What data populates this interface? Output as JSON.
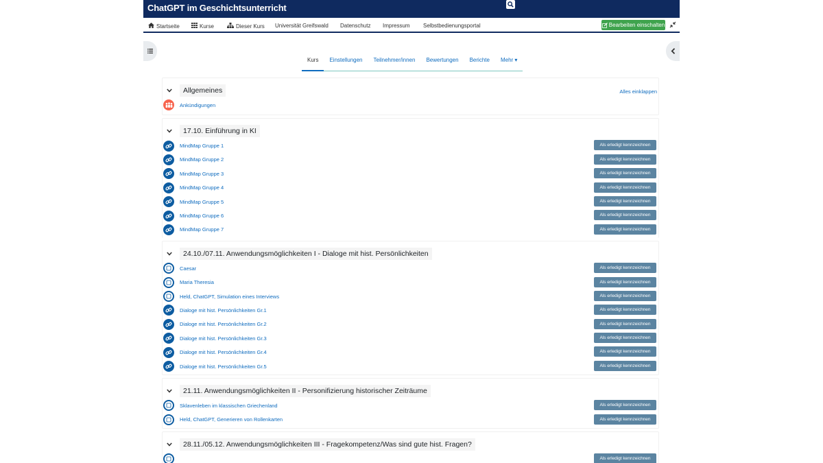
{
  "header": {
    "title": "ChatGPT im Geschichtsunterricht"
  },
  "nav": {
    "items": [
      {
        "label": "Startseite",
        "icon": "home-icon"
      },
      {
        "label": "Kurse",
        "icon": "grid-icon"
      },
      {
        "label": "Dieser Kurs",
        "icon": "sitemap-icon"
      },
      {
        "label": "Universität Greifswald"
      },
      {
        "label": "Datenschutz"
      },
      {
        "label": "Impressum"
      },
      {
        "label": "Selbstbedienungsportal"
      }
    ],
    "edit_label": "Bearbeiten einschalten"
  },
  "tabs": [
    {
      "label": "Kurs",
      "active": true
    },
    {
      "label": "Einstellungen"
    },
    {
      "label": "Teilnehmer/innen"
    },
    {
      "label": "Bewertungen"
    },
    {
      "label": "Berichte"
    },
    {
      "label": "Mehr ▾"
    }
  ],
  "course": {
    "collapse_all_label": "Alles einklappen",
    "done_label": "Als erledigt kennzeichnen",
    "sections": [
      {
        "title": "Allgemeines",
        "activities": [
          {
            "name": "Ankündigungen",
            "type": "forum",
            "done_button": false
          }
        ]
      },
      {
        "title": "17.10. Einführung in KI",
        "activities": [
          {
            "name": "MindMap Gruppe 1",
            "type": "url",
            "done_button": true
          },
          {
            "name": "MindMap Gruppe 2",
            "type": "url",
            "done_button": true
          },
          {
            "name": "MindMap Gruppe 3",
            "type": "url",
            "done_button": true
          },
          {
            "name": "MindMap Gruppe 4",
            "type": "url",
            "done_button": true
          },
          {
            "name": "MindMap Gruppe 5",
            "type": "url",
            "done_button": true
          },
          {
            "name": "MindMap Gruppe 6",
            "type": "url",
            "done_button": true
          },
          {
            "name": "MindMap Gruppe 7",
            "type": "url",
            "done_button": true
          }
        ]
      },
      {
        "title": "24.10./07.11. Anwendungsmöglichkeiten I - Dialoge mit hist. Persönlichkeiten",
        "activities": [
          {
            "name": "Caesar",
            "type": "h5p",
            "done_button": true
          },
          {
            "name": "Maria Theresia",
            "type": "h5p",
            "done_button": true
          },
          {
            "name": "Held, ChatGPT, Simulation eines Interviews",
            "type": "h5p",
            "done_button": true
          },
          {
            "name": "Dialoge mit hist. Persönlichkeiten Gr.1",
            "type": "url",
            "done_button": true
          },
          {
            "name": "Dialoge mit hist. Persönlichkeiten Gr.2",
            "type": "url",
            "done_button": true
          },
          {
            "name": "Dialoge mit hist. Persönlichkeiten Gr.3",
            "type": "url",
            "done_button": true
          },
          {
            "name": "Dialoge mit hist. Persönlichkeiten Gr.4",
            "type": "url",
            "done_button": true
          },
          {
            "name": "Dialoge mit hist. Persönlichkeiten Gr.5",
            "type": "url",
            "done_button": true
          }
        ]
      },
      {
        "title": "21.11. Anwendungsmöglichkeiten II - Personifizierung historischer Zeiträume",
        "activities": [
          {
            "name": "Sklavenleben im klassischen Griechenland",
            "type": "h5p",
            "done_button": true
          },
          {
            "name": "Held, ChatGPT, Generieren von Rollenkarten",
            "type": "h5p",
            "done_button": true
          }
        ]
      },
      {
        "title": "28.11./05.12. Anwendungsmöglichkeiten III - Fragekompetenz/Was sind gute hist. Fragen?",
        "activities": [
          {
            "name": "",
            "type": "h5p",
            "done_button": true
          }
        ]
      }
    ]
  },
  "colors": {
    "brand": "#0f2a5f",
    "link": "#0f6cbf",
    "edit_green": "#3fa34d",
    "done_button": "#5b84a1",
    "forum_icon": "#f7634d",
    "url_icon": "#0d5ca1"
  }
}
